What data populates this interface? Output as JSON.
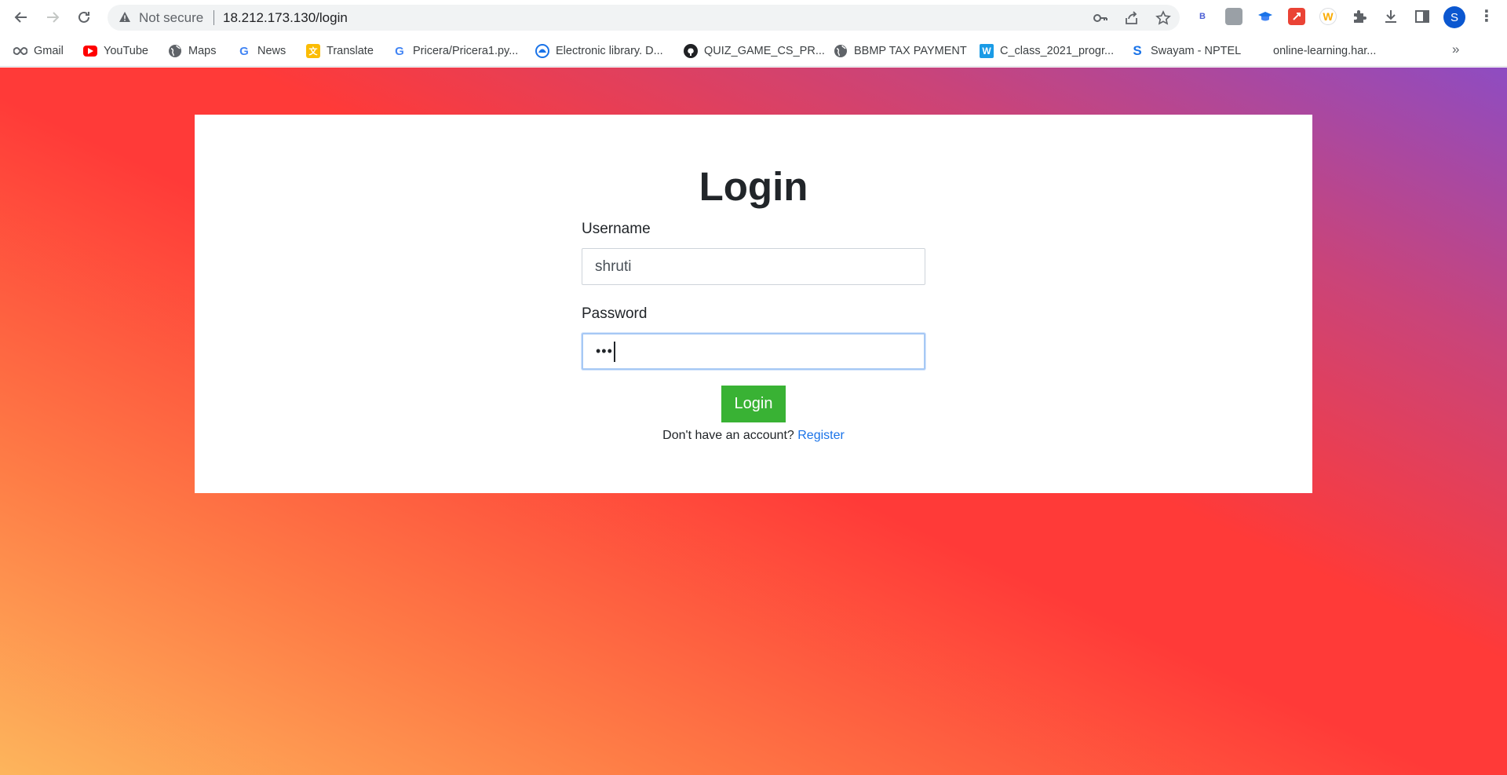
{
  "browser": {
    "security_label": "Not secure",
    "url": "18.212.173.130/login",
    "profile_initial": "S",
    "extensions": [
      {
        "name": "b-extension-icon",
        "text": "B",
        "color": "#4c5fd5"
      },
      {
        "name": "photo-extension-icon",
        "text": "",
        "color": "#9aa0a6"
      },
      {
        "name": "cap-extension-icon",
        "text": "",
        "color": "#1a73e8"
      },
      {
        "name": "rocket-extension-icon",
        "text": "",
        "color": "#ea4335"
      },
      {
        "name": "w-extension-icon",
        "text": "W",
        "color": "#f9ab00"
      }
    ]
  },
  "bookmarks": [
    {
      "label": "Gmail",
      "icon": "infinity-icon"
    },
    {
      "label": "YouTube",
      "icon": "youtube-icon"
    },
    {
      "label": "Maps",
      "icon": "globe-icon"
    },
    {
      "label": "News",
      "icon": "google-icon"
    },
    {
      "label": "Translate",
      "icon": "translate-icon"
    },
    {
      "label": "Pricera/Pricera1.py...",
      "icon": "google-icon"
    },
    {
      "label": "Electronic library. D...",
      "icon": "library-icon"
    },
    {
      "label": "QUIZ_GAME_CS_PR...",
      "icon": "github-icon"
    },
    {
      "label": "BBMP TAX PAYMENT",
      "icon": "globe-icon"
    },
    {
      "label": "C_class_2021_progr...",
      "icon": "w-icon"
    },
    {
      "label": "Swayam - NPTEL",
      "icon": "swayam-icon"
    },
    {
      "label": "online-learning.har...",
      "icon": "harvard-icon"
    }
  ],
  "bookmarks_more": "»",
  "login": {
    "title": "Login",
    "username_label": "Username",
    "username_value": "shruti",
    "password_label": "Password",
    "password_value": "•••",
    "submit_label": "Login",
    "register_prompt": "Don't have an account?",
    "register_link": "Register"
  },
  "colors": {
    "accent_button": "#39b234",
    "link": "#1a73e8",
    "gradient_start": "#fdb55c",
    "gradient_mid": "#ff3a38",
    "gradient_end": "#8e4cc2"
  }
}
